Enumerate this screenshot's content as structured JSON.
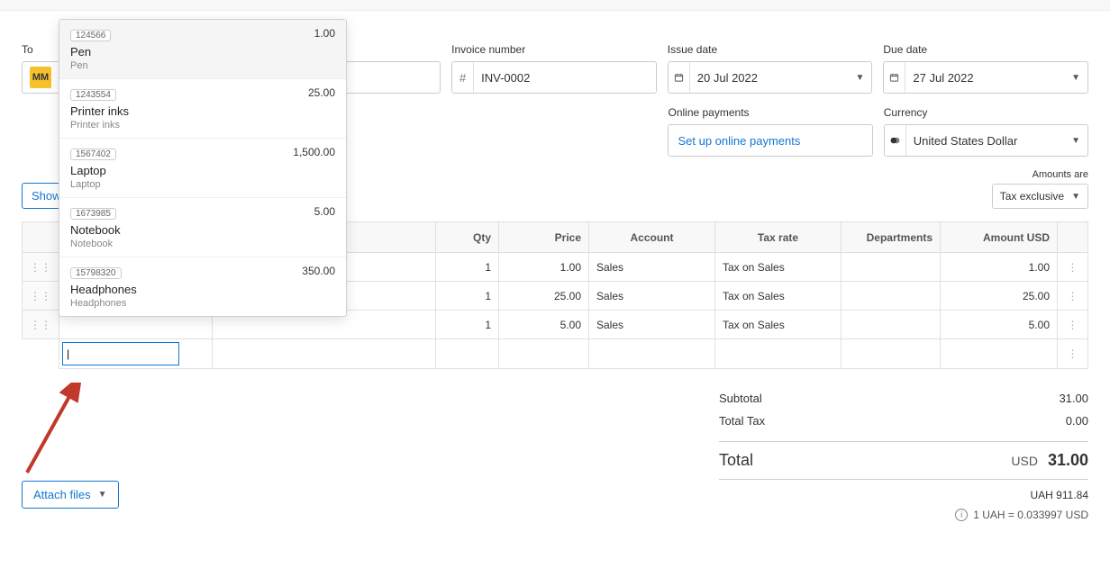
{
  "header": {
    "to_label": "To",
    "to_avatar": "MM",
    "invno_label": "Invoice number",
    "invno_value": "INV-0002",
    "issue_label": "Issue date",
    "issue_value": "20 Jul 2022",
    "due_label": "Due date",
    "due_value": "27 Jul 2022",
    "online_label": "Online payments",
    "online_link_text": "Set up online payments",
    "currency_label": "Currency",
    "currency_value": "United States Dollar",
    "amounts_label": "Amounts are",
    "tax_mode": "Tax exclusive",
    "show_btn": "Show"
  },
  "table": {
    "headers": {
      "qty": "Qty",
      "price": "Price",
      "account": "Account",
      "taxrate": "Tax rate",
      "dept": "Departments",
      "amount": "Amount USD"
    },
    "rows": [
      {
        "qty": "1",
        "price": "1.00",
        "account": "Sales",
        "taxrate": "Tax on Sales",
        "dept": "",
        "amount": "1.00"
      },
      {
        "qty": "1",
        "price": "25.00",
        "account": "Sales",
        "taxrate": "Tax on Sales",
        "dept": "",
        "amount": "25.00"
      },
      {
        "qty": "1",
        "price": "5.00",
        "account": "Sales",
        "taxrate": "Tax on Sales",
        "dept": "",
        "amount": "5.00"
      }
    ]
  },
  "totals": {
    "subtotal_label": "Subtotal",
    "subtotal_value": "31.00",
    "totaltax_label": "Total Tax",
    "totaltax_value": "0.00",
    "total_label": "Total",
    "total_currency": "USD",
    "total_value": "31.00",
    "converted": "UAH 911.84",
    "exchange": "1 UAH = 0.033997 USD"
  },
  "attach_label": "Attach files",
  "dropdown": [
    {
      "code": "124566",
      "name": "Pen",
      "desc": "Pen",
      "price": "1.00"
    },
    {
      "code": "1243554",
      "name": "Printer inks",
      "desc": "Printer inks",
      "price": "25.00"
    },
    {
      "code": "1567402",
      "name": "Laptop",
      "desc": "Laptop",
      "price": "1,500.00"
    },
    {
      "code": "1673985",
      "name": "Notebook",
      "desc": "Notebook",
      "price": "5.00"
    },
    {
      "code": "15798320",
      "name": "Headphones",
      "desc": "Headphones",
      "price": "350.00"
    }
  ]
}
